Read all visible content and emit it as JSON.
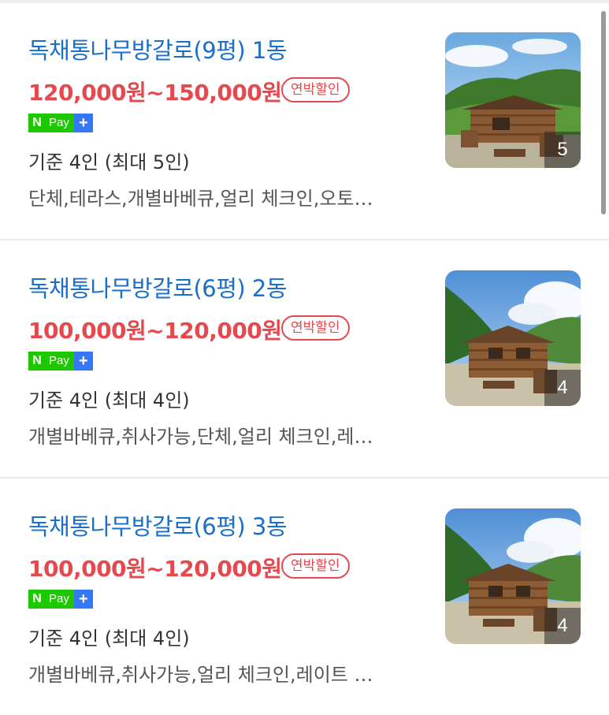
{
  "listings": [
    {
      "title": "독채통나무방갈로(9평) 1동",
      "price": "120,000원~150,000원",
      "discount": "연박할인",
      "npay": {
        "n": "N",
        "pay": "Pay",
        "plus": "+"
      },
      "capacity": "기준 4인 (최대 5인)",
      "tags": "단체,테라스,개별바베큐,얼리 체크인,오토…",
      "photo_count": "5"
    },
    {
      "title": "독채통나무방갈로(6평) 2동",
      "price": "100,000원~120,000원",
      "discount": "연박할인",
      "npay": {
        "n": "N",
        "pay": "Pay",
        "plus": "+"
      },
      "capacity": "기준 4인 (최대 4인)",
      "tags": "개별바베큐,취사가능,단체,얼리 체크인,레…",
      "photo_count": "4"
    },
    {
      "title": "독채통나무방갈로(6평) 3동",
      "price": "100,000원~120,000원",
      "discount": "연박할인",
      "npay": {
        "n": "N",
        "pay": "Pay",
        "plus": "+"
      },
      "capacity": "기준 4인 (최대 4인)",
      "tags": "개별바베큐,취사가능,얼리 체크인,레이트 …",
      "photo_count": "4"
    }
  ],
  "colors": {
    "title": "#1a6fc9",
    "price": "#e5484d",
    "npay_green": "#1ec800",
    "npay_blue": "#3478f6"
  }
}
